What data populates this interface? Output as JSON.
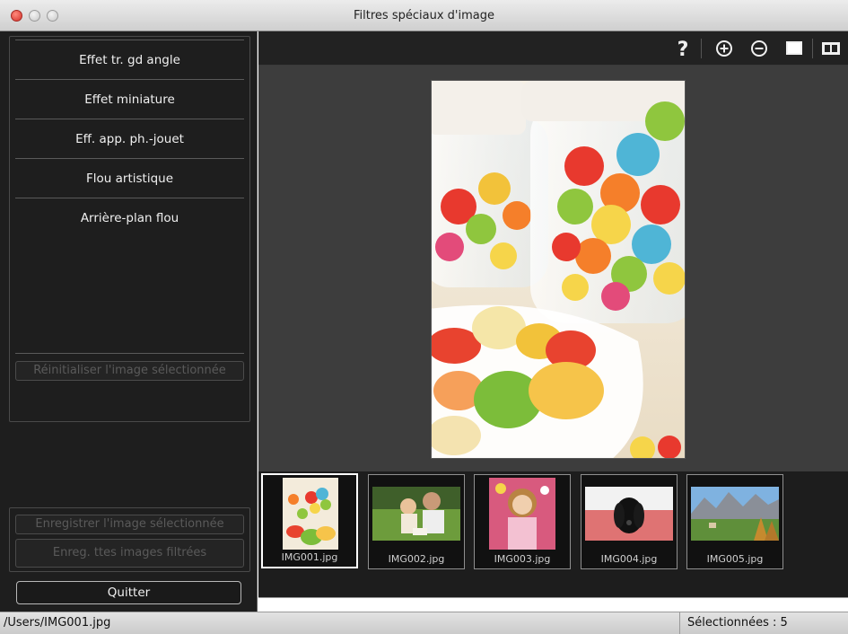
{
  "window": {
    "title": "Filtres spéciaux d'image"
  },
  "filters": [
    {
      "label": "Effet tr. gd angle"
    },
    {
      "label": "Effet miniature"
    },
    {
      "label": "Eff. app. ph.-jouet"
    },
    {
      "label": "Flou artistique"
    },
    {
      "label": "Arrière-plan flou"
    }
  ],
  "buttons": {
    "reset": "Réinitialiser l'image sélectionnée",
    "save_selected": "Enregistrer l'image sélectionnée",
    "save_all": "Enreg. ttes images filtrées",
    "quit": "Quitter"
  },
  "toolbar": {
    "help_icon": "question-mark-icon",
    "zoom_in_icon": "zoom-in-icon",
    "zoom_out_icon": "zoom-out-icon",
    "full_screen_icon": "full-screen-icon",
    "compare_icon": "compare-view-icon"
  },
  "thumbnails": [
    {
      "filename": "IMG001.jpg",
      "selected": true
    },
    {
      "filename": "IMG002.jpg",
      "selected": false
    },
    {
      "filename": "IMG003.jpg",
      "selected": false
    },
    {
      "filename": "IMG004.jpg",
      "selected": false
    },
    {
      "filename": "IMG005.jpg",
      "selected": false
    }
  ],
  "status": {
    "path": "/Users/IMG001.jpg",
    "selected_count": "Sélectionnées : 5"
  },
  "colors": {
    "panel_bg": "#1e1e1e",
    "preview_bg": "#3d3d3d",
    "disabled_text": "#5a5a5a"
  }
}
